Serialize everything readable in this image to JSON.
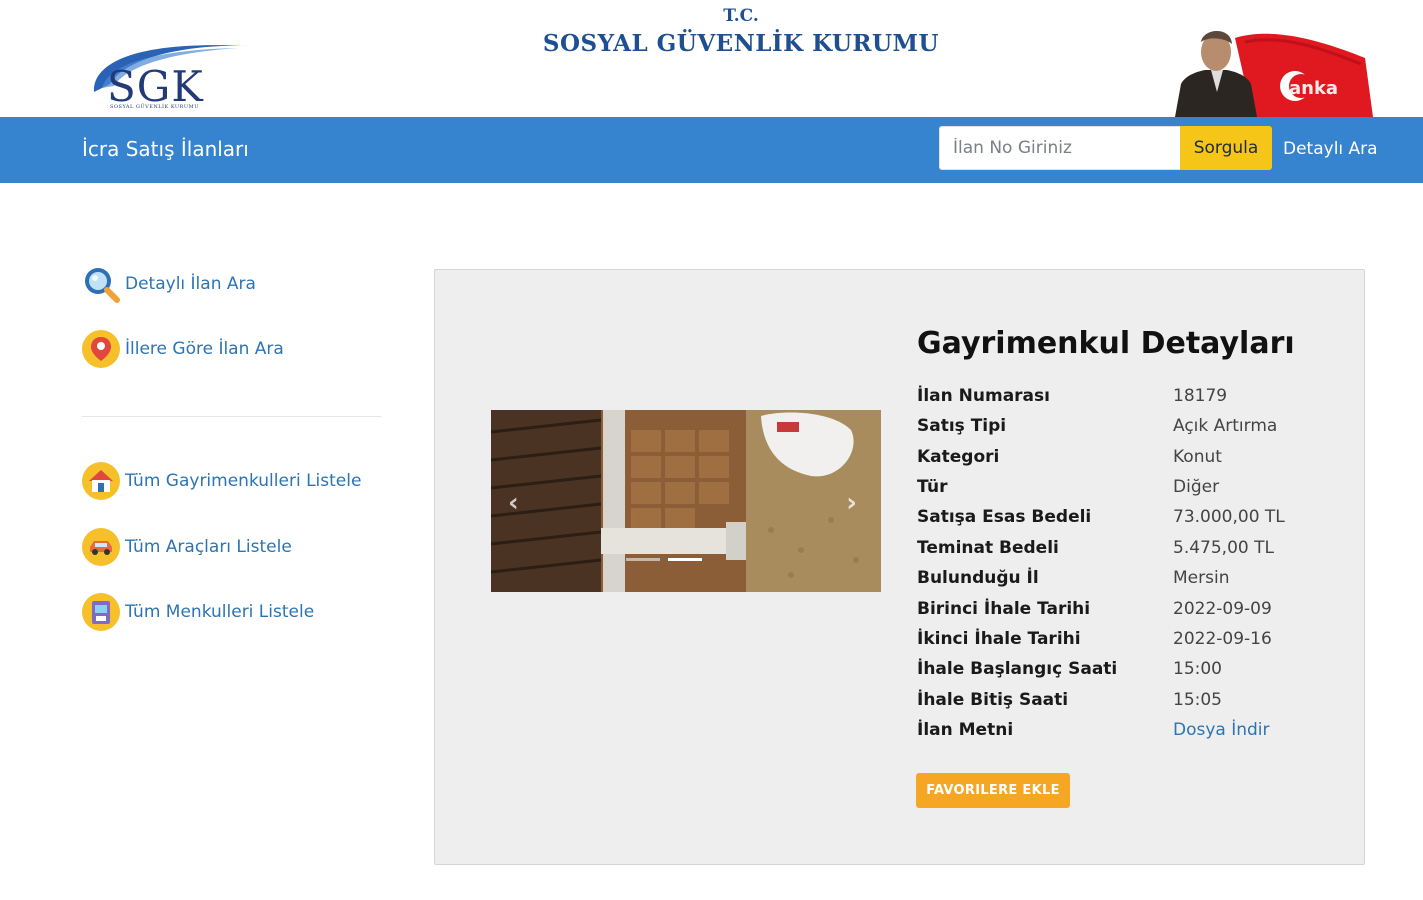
{
  "header": {
    "logo_text": "SGK",
    "logo_subtext": "SOSYAL GÜVENLİK KURUMU",
    "tc": "T.C.",
    "institution": "SOSYAL GÜVENLİK KURUMU",
    "flag_watermark": "anka"
  },
  "navbar": {
    "brand": "İcra Satış İlanları",
    "search_placeholder": "İlan No Giriniz",
    "search_button": "Sorgula",
    "detailed_search": "Detaylı Ara"
  },
  "sidebar": {
    "top_items": [
      {
        "label": "Detaylı İlan Ara",
        "icon": "magnifier-icon"
      },
      {
        "label": "İllere Göre İlan Ara",
        "icon": "map-pin-icon"
      }
    ],
    "list_items": [
      {
        "label": "Tüm Gayrimenkulleri Listele",
        "icon": "house-icon"
      },
      {
        "label": "Tüm Araçları Listele",
        "icon": "car-icon"
      },
      {
        "label": "Tüm Menkulleri Listele",
        "icon": "box-icon"
      }
    ]
  },
  "detail": {
    "title": "Gayrimenkul Detayları",
    "rows": [
      {
        "label": "İlan Numarası",
        "value": "18179"
      },
      {
        "label": "Satış Tipi",
        "value": "Açık Artırma"
      },
      {
        "label": "Kategori",
        "value": "Konut"
      },
      {
        "label": "Tür",
        "value": "Diğer"
      },
      {
        "label": "Satışa Esas Bedeli",
        "value": "73.000,00 TL"
      },
      {
        "label": "Teminat Bedeli",
        "value": "5.475,00 TL"
      },
      {
        "label": "Bulunduğu İl",
        "value": "Mersin"
      },
      {
        "label": "Birinci İhale Tarihi",
        "value": "2022-09-09"
      },
      {
        "label": "İkinci İhale Tarihi",
        "value": "2022-09-16"
      },
      {
        "label": "İhale Başlangıç Saati",
        "value": "15:00"
      },
      {
        "label": "İhale Bitiş Saati",
        "value": "15:05"
      },
      {
        "label": "İlan Metni",
        "value": "Dosya İndir"
      }
    ],
    "favorite_button": "FAVORILERE EKLE"
  },
  "carousel": {
    "prev_icon": "chevron-left-icon",
    "next_icon": "chevron-right-icon"
  },
  "colors": {
    "navbar": "#3683cf",
    "search_button": "#f5c518",
    "favorite_button": "#f5a623",
    "link": "#2c74b3"
  }
}
